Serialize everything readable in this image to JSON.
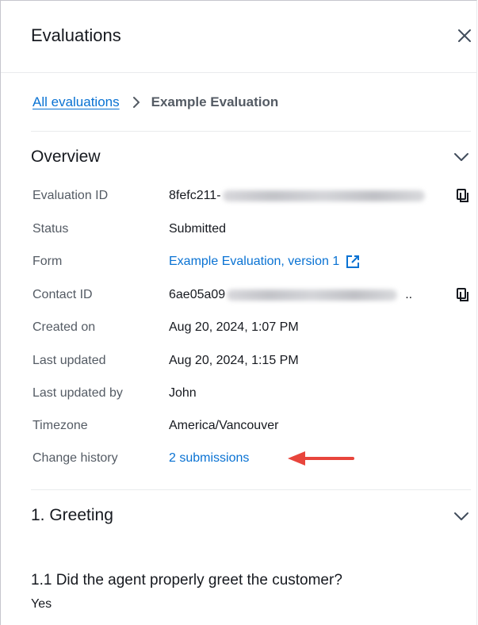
{
  "panel": {
    "title": "Evaluations",
    "close_icon": "close-icon"
  },
  "breadcrumb": {
    "parent": "All evaluations",
    "current": "Example Evaluation"
  },
  "overview": {
    "title": "Overview",
    "evaluation_id_label": "Evaluation ID",
    "evaluation_id_value": "8fefc211-",
    "status_label": "Status",
    "status_value": "Submitted",
    "form_label": "Form",
    "form_value": "Example Evaluation, version 1",
    "contact_id_label": "Contact ID",
    "contact_id_value": "6ae05a09",
    "contact_id_ellipsis": "..",
    "created_on_label": "Created on",
    "created_on_value": "Aug 20, 2024, 1:07 PM",
    "last_updated_label": "Last updated",
    "last_updated_value": "Aug 20, 2024, 1:15 PM",
    "last_updated_by_label": "Last updated by",
    "last_updated_by_value": "John",
    "timezone_label": "Timezone",
    "timezone_value": "America/Vancouver",
    "change_history_label": "Change history",
    "change_history_value": "2 submissions"
  },
  "greeting": {
    "title": "1. Greeting",
    "question": "1.1 Did the agent properly greet the customer?",
    "answer": "Yes"
  },
  "colors": {
    "link": "#0972d3",
    "arrow": "#e8453c",
    "text": "#16191f",
    "muted": "#545b64"
  }
}
